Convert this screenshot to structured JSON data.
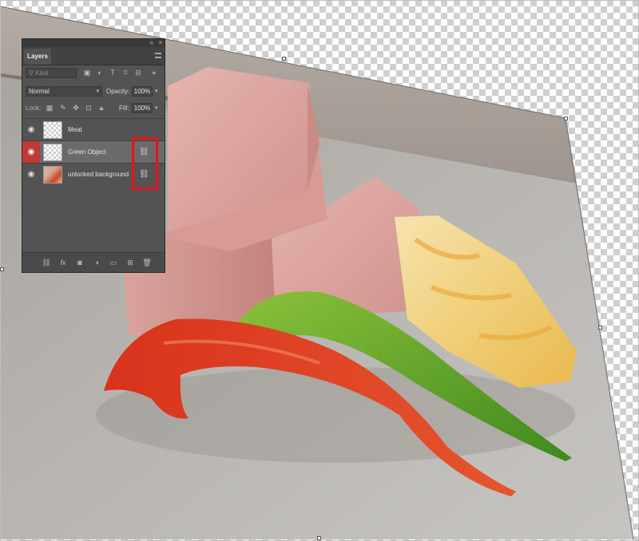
{
  "panel": {
    "collapse_glyph": "«",
    "close_glyph": "×",
    "tab_label": "Layers",
    "filter": {
      "placeholder": "Kind",
      "icons": [
        "image-filter-icon",
        "adjustment-filter-icon",
        "type-filter-icon",
        "shape-filter-icon",
        "smart-object-filter-icon"
      ]
    },
    "blend_mode": "Normal",
    "opacity_label": "Opacity:",
    "opacity_value": "100%",
    "lock_label": "Lock:",
    "fill_label": "Fill:",
    "fill_value": "100%",
    "layers": [
      {
        "name": "Meat",
        "selected": false,
        "linked": false
      },
      {
        "name": "Green Object",
        "selected": true,
        "linked": true
      },
      {
        "name": "unlocked background",
        "selected": false,
        "linked": true
      }
    ],
    "footer_icons": [
      "link-layers-icon",
      "fx-icon",
      "layer-mask-icon",
      "adjustment-layer-icon",
      "new-group-icon",
      "new-layer-icon",
      "delete-layer-icon"
    ]
  },
  "colors": {
    "panel_bg": "#535353",
    "selected_eye": "#c0393a",
    "highlight_box": "#e8141c"
  }
}
